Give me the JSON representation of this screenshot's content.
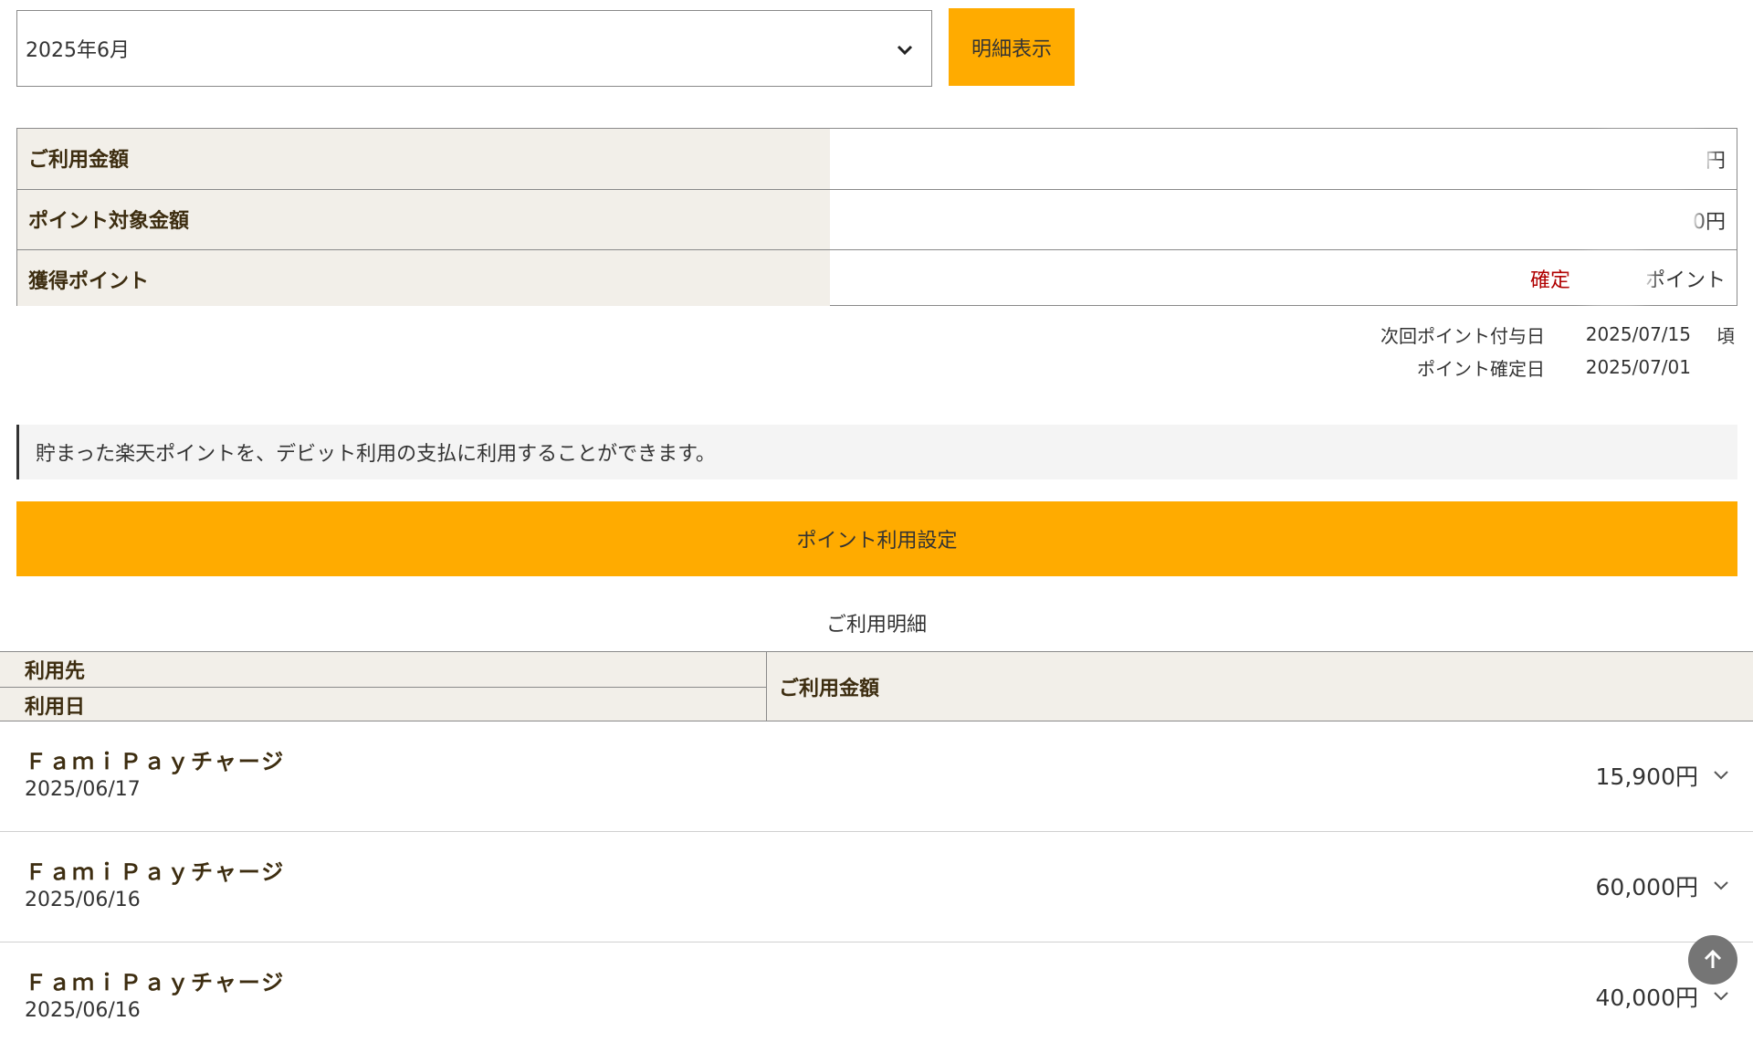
{
  "period": {
    "selected_month": "2025年6月",
    "show_button": "明細表示"
  },
  "summary": {
    "rows": [
      {
        "label": "ご利用金額",
        "value": "円",
        "status": ""
      },
      {
        "label": "ポイント対象金額",
        "value": "0円",
        "status": ""
      },
      {
        "label": "獲得ポイント",
        "value": "ポイント",
        "status": "確定"
      }
    ]
  },
  "point_dates": {
    "next_grant_label": "次回ポイント付与日",
    "next_grant_date": "2025/07/15",
    "next_grant_suffix": "頃",
    "confirm_label": "ポイント確定日",
    "confirm_date": "2025/07/01"
  },
  "notice": "貯まった楽天ポイントを、デビット利用の支払に利用することができます。",
  "point_setting_button": "ポイント利用設定",
  "details": {
    "title": "ご利用明細",
    "headers": {
      "merchant": "利用先",
      "date": "利用日",
      "amount": "ご利用金額"
    },
    "transactions": [
      {
        "merchant": "ＦａｍｉＰａｙチャージ",
        "date": "2025/06/17",
        "amount": "15,900円"
      },
      {
        "merchant": "ＦａｍｉＰａｙチャージ",
        "date": "2025/06/16",
        "amount": "60,000円"
      },
      {
        "merchant": "ＦａｍｉＰａｙチャージ",
        "date": "2025/06/16",
        "amount": "40,000円"
      }
    ]
  },
  "colors": {
    "accent": "#ffab00",
    "header_bg": "#f2efe9",
    "status_red": "#b00000"
  },
  "icons": {
    "select_arrow": "chevron-down-icon",
    "row_expand": "chevron-down-icon",
    "scroll_top": "arrow-up-icon"
  }
}
